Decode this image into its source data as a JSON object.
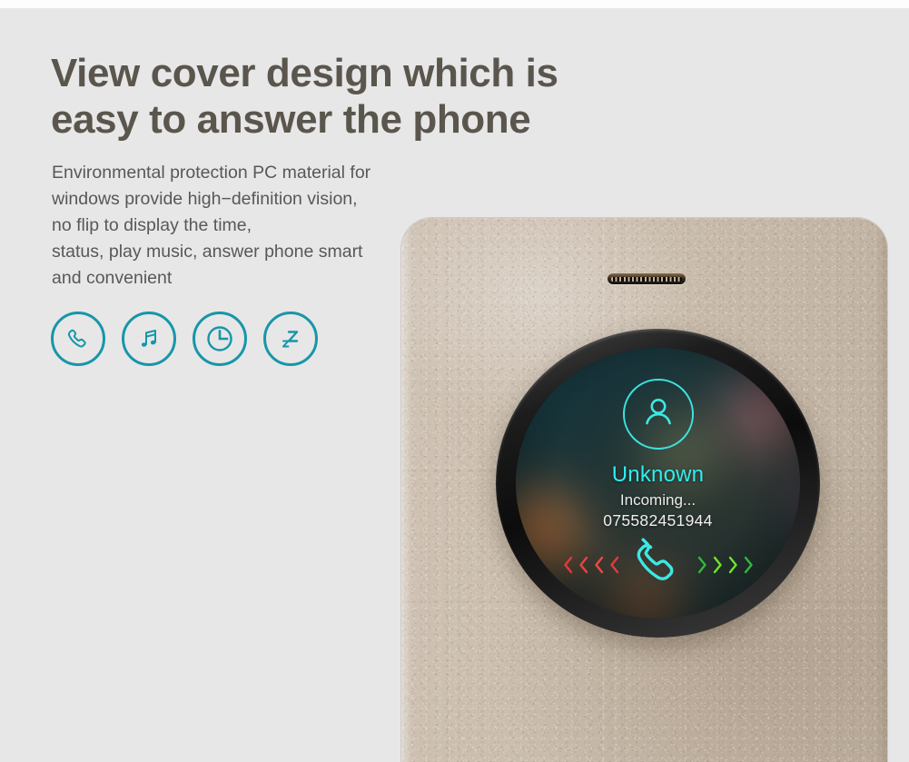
{
  "page": {
    "background_color": "#e7e7e7",
    "headline": "View cover design which is\neasy to answer the phone",
    "headline_color": "#5b564d",
    "body_text": "Environmental protection PC material for\nwindows provide high−definition vision,\nno flip to display the time,\nstatus, play music, answer phone smart\nand convenient",
    "body_color": "#585858"
  },
  "features": {
    "accent_color": "#1796a9",
    "items": [
      {
        "icon": "phone-icon",
        "label": "answer phone"
      },
      {
        "icon": "music-note-icon",
        "label": "play music"
      },
      {
        "icon": "clock-icon",
        "label": "display the time"
      },
      {
        "icon": "sleep-zz-icon",
        "label": "sleep status"
      }
    ]
  },
  "phone_case": {
    "material_color": "#c9bcac",
    "edge_highlight_color": "#e2d8cc",
    "speaker_grille": "earpiece-speaker-grille"
  },
  "call_screen": {
    "bezel_color": "#101010",
    "avatar_icon": "person-avatar-icon",
    "caller_name": "Unknown",
    "caller_name_color": "#2fedee",
    "status": "Incoming...",
    "status_color": "#eaeaea",
    "number": "075582451944",
    "number_color": "#efefef",
    "decline": {
      "label": "decline",
      "direction": "left",
      "chevron_count": 4,
      "color": "#e23b3b"
    },
    "answer": {
      "label": "answer",
      "direction": "right",
      "chevron_count": 4,
      "color": "#3fd43f",
      "handset_icon": "answer-handset-icon",
      "handset_color": "#3ce8e4"
    }
  }
}
